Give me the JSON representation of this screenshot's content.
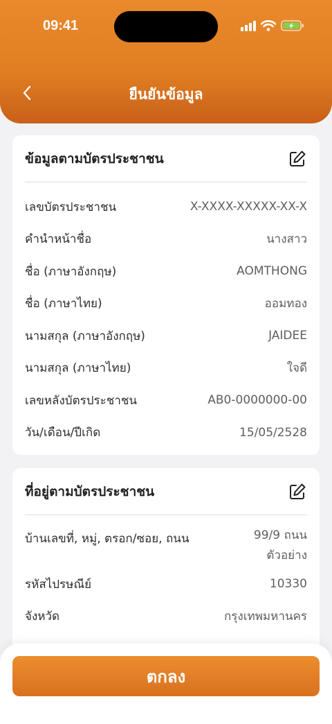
{
  "status_bar": {
    "time": "09:41"
  },
  "header": {
    "title": "ยืนยันข้อมูล"
  },
  "id_card_section": {
    "title": "ข้อมูลตามบัตรประชาชน",
    "fields": [
      {
        "label": "เลขบัตรประชาชน",
        "value": "X-XXXX-XXXXX-XX-X"
      },
      {
        "label": "คำนำหน้าชื่อ",
        "value": "นางสาว"
      },
      {
        "label": "ชื่อ (ภาษาอังกฤษ)",
        "value": "AOMTHONG"
      },
      {
        "label": "ชื่อ (ภาษาไทย)",
        "value": "ออมทอง"
      },
      {
        "label": "นามสกุล (ภาษาอังกฤษ)",
        "value": "JAIDEE"
      },
      {
        "label": "นามสกุล (ภาษาไทย)",
        "value": "ใจดี"
      },
      {
        "label": "เลขหลังบัตรประชาชน",
        "value": "AB0-0000000-00"
      },
      {
        "label": "วัน/เดือน/ปีเกิด",
        "value": "15/05/2528"
      }
    ]
  },
  "address_section": {
    "title": "ที่อยู่ตามบัตรประชาชน",
    "fields": [
      {
        "label": "บ้านเลขที่, หมู่, ตรอก/ซอย, ถนน",
        "value_line1": "99/9 ถนน",
        "value_line2": "ตัวอย่าง"
      },
      {
        "label": "รหัสไปรษณีย์",
        "value": "10330"
      },
      {
        "label": "จังหวัด",
        "value": "กรุงเทพมหานคร"
      }
    ]
  },
  "footer": {
    "confirm_label": "ตกลง"
  },
  "colors": {
    "accent": "#e07d22",
    "accent_dark": "#c9601a"
  }
}
